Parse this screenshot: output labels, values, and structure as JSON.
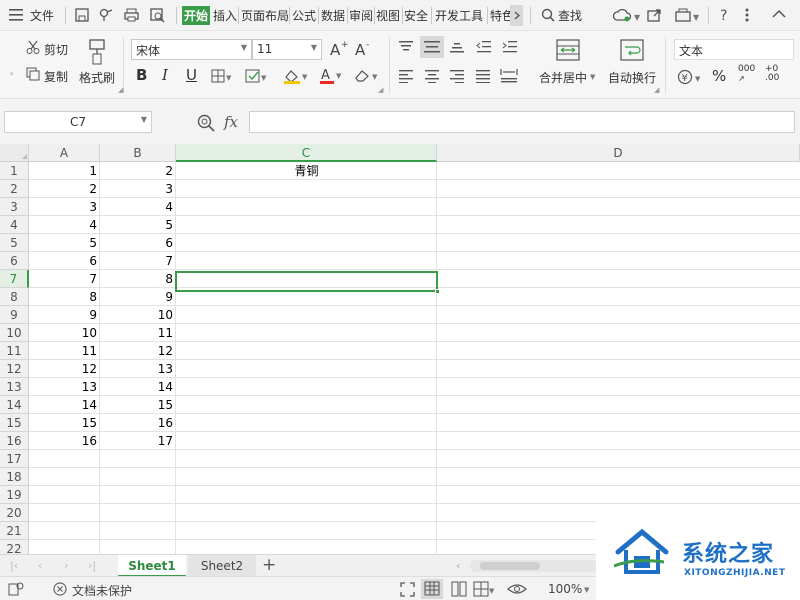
{
  "menubar": {
    "file": "文件",
    "tabs": [
      "开始",
      "插入",
      "页面布局",
      "公式",
      "数据",
      "审阅",
      "视图",
      "安全",
      "开发工具",
      "特色"
    ],
    "active_tab": "开始",
    "search": "查找"
  },
  "ribbon": {
    "cut": "剪切",
    "copy": "复制",
    "format_painter": "格式刷",
    "font_name": "宋体",
    "font_size": "11",
    "merge_center": "合并居中",
    "wrap_text": "自动换行",
    "number_format": "文本",
    "percent": "%",
    "thousands": "000",
    "decimal_inc": ".00",
    "bold": "B",
    "italic": "I",
    "underline": "U"
  },
  "formula_bar": {
    "name_box": "C7",
    "fx": "fx",
    "value": ""
  },
  "grid": {
    "columns": [
      "A",
      "B",
      "C",
      "D"
    ],
    "selected_column": "C",
    "selected_row": "7",
    "header_c1": "青铜",
    "rows": [
      {
        "row": "1",
        "A": "1",
        "B": "2"
      },
      {
        "row": "2",
        "A": "2",
        "B": "3"
      },
      {
        "row": "3",
        "A": "3",
        "B": "4"
      },
      {
        "row": "4",
        "A": "4",
        "B": "5"
      },
      {
        "row": "5",
        "A": "5",
        "B": "6"
      },
      {
        "row": "6",
        "A": "6",
        "B": "7"
      },
      {
        "row": "7",
        "A": "7",
        "B": "8"
      },
      {
        "row": "8",
        "A": "8",
        "B": "9"
      },
      {
        "row": "9",
        "A": "9",
        "B": "10"
      },
      {
        "row": "10",
        "A": "10",
        "B": "11"
      },
      {
        "row": "11",
        "A": "11",
        "B": "12"
      },
      {
        "row": "12",
        "A": "12",
        "B": "13"
      },
      {
        "row": "13",
        "A": "13",
        "B": "14"
      },
      {
        "row": "14",
        "A": "14",
        "B": "15"
      },
      {
        "row": "15",
        "A": "15",
        "B": "16"
      },
      {
        "row": "16",
        "A": "16",
        "B": "17"
      },
      {
        "row": "17",
        "A": "",
        "B": ""
      },
      {
        "row": "18",
        "A": "",
        "B": ""
      },
      {
        "row": "19",
        "A": "",
        "B": ""
      },
      {
        "row": "20",
        "A": "",
        "B": ""
      },
      {
        "row": "21",
        "A": "",
        "B": ""
      },
      {
        "row": "22",
        "A": "",
        "B": ""
      }
    ]
  },
  "sheets": {
    "tabs": [
      "Sheet1",
      "Sheet2"
    ],
    "active": "Sheet1",
    "add": "+"
  },
  "status": {
    "protect": "文档未保护",
    "zoom": "100%"
  },
  "watermark": {
    "brand": "系统之家",
    "url": "XITONGZHIJIA.NET"
  },
  "colors": {
    "accent": "#3a9b49",
    "watermark_blue": "#1f6fc7"
  }
}
